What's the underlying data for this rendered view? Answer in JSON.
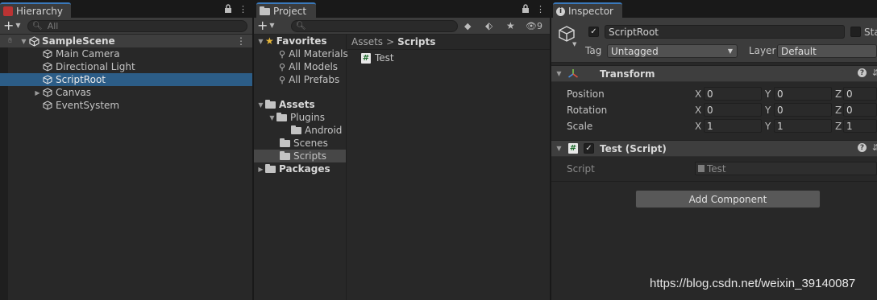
{
  "hierarchy": {
    "tab_label": "Hierarchy",
    "search_placeholder": "All",
    "scene_name": "SampleScene",
    "items": [
      {
        "label": "Main Camera"
      },
      {
        "label": "Directional Light"
      },
      {
        "label": "ScriptRoot"
      },
      {
        "label": "Canvas"
      },
      {
        "label": "EventSystem"
      }
    ],
    "selected_item": "ScriptRoot"
  },
  "project": {
    "tab_label": "Project",
    "hidden_count": "9",
    "tree": {
      "favorites": "Favorites",
      "favorite_items": [
        "All Materials",
        "All Models",
        "All Prefabs"
      ],
      "assets": "Assets",
      "plugins": "Plugins",
      "android": "Android",
      "scenes": "Scenes",
      "scripts": "Scripts",
      "packages": "Packages"
    },
    "breadcrumb": {
      "root": "Assets",
      "separator": ">",
      "current": "Scripts"
    },
    "files": [
      {
        "name": "Test"
      }
    ]
  },
  "inspector": {
    "tab_label": "Inspector",
    "object_name": "ScriptRoot",
    "static_label": "Sta",
    "tag_label": "Tag",
    "tag_value": "Untagged",
    "layer_label": "Layer",
    "layer_value": "Default",
    "transform": {
      "title": "Transform",
      "rows": [
        {
          "label": "Position",
          "x": "0",
          "y": "0",
          "z": "0"
        },
        {
          "label": "Rotation",
          "x": "0",
          "y": "0",
          "z": "0"
        },
        {
          "label": "Scale",
          "x": "1",
          "y": "1",
          "z": "1"
        }
      ],
      "axis_labels": [
        "X",
        "Y",
        "Z"
      ]
    },
    "script_component": {
      "title": "Test (Script)",
      "field_label": "Script",
      "field_value": "Test"
    },
    "add_component_label": "Add Component"
  },
  "watermark": "https://blog.csdn.net/weixin_39140087"
}
